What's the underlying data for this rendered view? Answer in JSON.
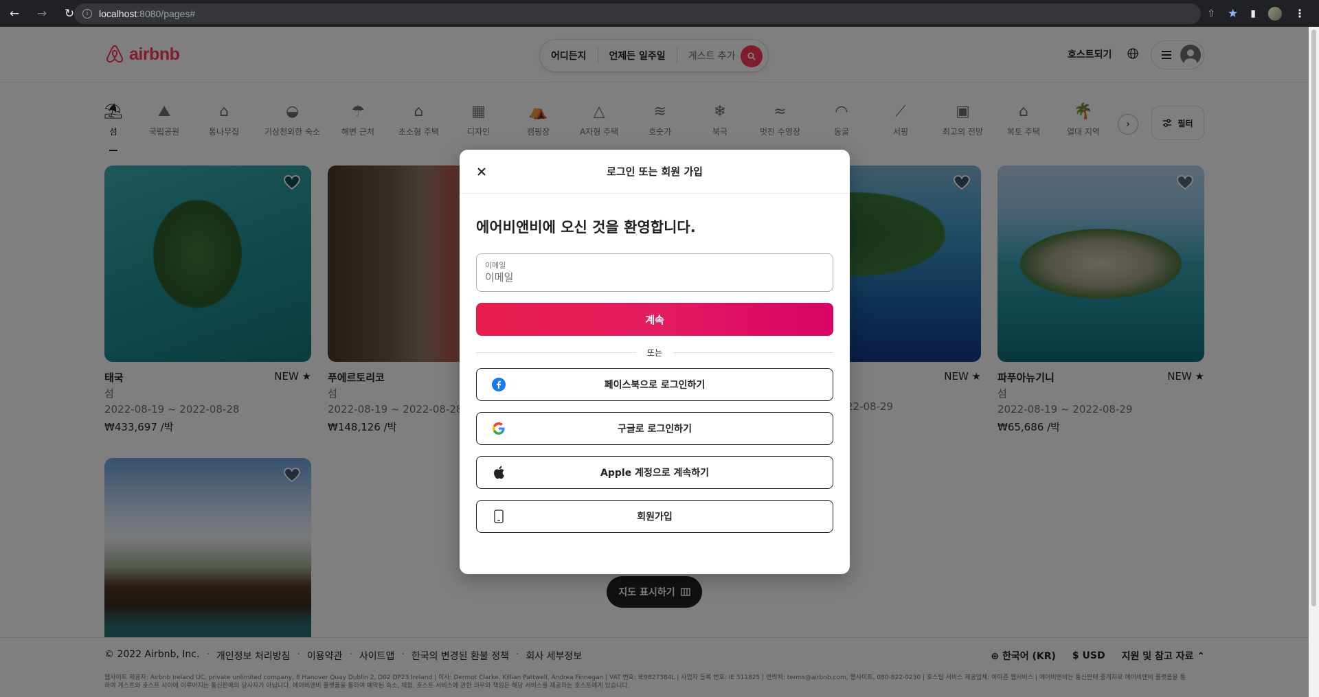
{
  "browser": {
    "url_host": "localhost",
    "url_rest": ":8080/pages#"
  },
  "header": {
    "logo_text": "airbnb",
    "search": {
      "where": "어디든지",
      "when": "언제든 일주일",
      "guests": "게스트 추가"
    },
    "host_link": "호스트되기"
  },
  "categories": [
    {
      "label": "섬",
      "icon": "island-icon",
      "glyph": "⛱"
    },
    {
      "label": "국립공원",
      "icon": "national-park-icon",
      "glyph": "⛰"
    },
    {
      "label": "통나무집",
      "icon": "cabin-icon",
      "glyph": "⌂"
    },
    {
      "label": "기상천외한 숙소",
      "icon": "ufo-icon",
      "glyph": "◒"
    },
    {
      "label": "해변 근처",
      "icon": "beach-umbrella-icon",
      "glyph": "☂"
    },
    {
      "label": "초소형 주택",
      "icon": "tiny-home-icon",
      "glyph": "⌂"
    },
    {
      "label": "디자인",
      "icon": "design-icon",
      "glyph": "▦"
    },
    {
      "label": "캠핑장",
      "icon": "camping-icon",
      "glyph": "⛺"
    },
    {
      "label": "A자형 주택",
      "icon": "a-frame-icon",
      "glyph": "△"
    },
    {
      "label": "호숫가",
      "icon": "lake-icon",
      "glyph": "≋"
    },
    {
      "label": "북극",
      "icon": "arctic-icon",
      "glyph": "❄"
    },
    {
      "label": "멋진 수영장",
      "icon": "pool-icon",
      "glyph": "≈"
    },
    {
      "label": "동굴",
      "icon": "cave-icon",
      "glyph": "◠"
    },
    {
      "label": "서핑",
      "icon": "surfing-icon",
      "glyph": "⟋"
    },
    {
      "label": "최고의 전망",
      "icon": "view-icon",
      "glyph": "▣"
    },
    {
      "label": "복토 주택",
      "icon": "earth-home-icon",
      "glyph": "⌂"
    },
    {
      "label": "열대 지역",
      "icon": "tropical-icon",
      "glyph": "🌴"
    }
  ],
  "filter_label": "필터",
  "listings": [
    {
      "title": "태국",
      "badge": "NEW ★",
      "type": "섬",
      "dates": "2022-08-19 ~ 2022-08-28",
      "price": "₩433,697 /박"
    },
    {
      "title": "푸에르토리코",
      "badge": "",
      "type": "섬",
      "dates": "2022-08-19 ~ 2022-08-28",
      "price": "₩148,126 /박"
    },
    {
      "title": "",
      "badge": "NEW ★",
      "type": "",
      "dates": "22-08-29",
      "price": ""
    },
    {
      "title": "파푸아뉴기니",
      "badge": "NEW ★",
      "type": "섬",
      "dates": "2022-08-19 ~ 2022-08-29",
      "price": "₩65,686 /박"
    }
  ],
  "map_button": "지도 표시하기",
  "footer": {
    "copyright": "© 2022 Airbnb, Inc.",
    "links": [
      "개인정보 처리방침",
      "이용약관",
      "사이트맵",
      "한국의 변경된 환불 정책",
      "회사 세부정보"
    ],
    "language": "한국어 (KR)",
    "currency_symbol": "$",
    "currency": "USD",
    "support": "지원 및 참고 자료",
    "fine_print": "웹사이트 제공자: Airbnb Ireland UC, private unlimited company, 8 Hanover Quay Dublin 2, D02 DP23 Ireland | 이사: Dermot Clarke, Killian Pattwell, Andrea Finnegan | VAT 번호: IE9827384L | 사업자 등록 번호: IE 511825 | 연락처: terms@airbnb.com, 웹사이트, 080-822-0230 | 호스팅 서비스 제공업체: 아마존 웹서비스 | 에어비앤비는 통신판매 중개자로 에어비앤비 플랫폼을 통하여 게스트와 호스트 사이에 이루어지는 통신판매의 당사자가 아닙니다. 에어비앤비 플랫폼을 통하여 예약된 숙소, 체험, 호스트 서비스에 관한 의무와 책임은 해당 서비스를 제공하는 호스트에게 있습니다."
  },
  "modal": {
    "title": "로그인 또는 회원 가입",
    "welcome": "에어비앤비에 오신 것을 환영합니다.",
    "email_label": "이메일",
    "email_placeholder": "이메일",
    "continue": "계속",
    "or": "또는",
    "facebook": "페이스북으로 로그인하기",
    "google": "구글로 로그인하기",
    "apple": "Apple 계정으로 계속하기",
    "signup": "회원가입"
  },
  "colors": {
    "brand": "#FF385C",
    "continue_start": "#E61E4D",
    "continue_end": "#D70466",
    "facebook": "#1877F2"
  }
}
